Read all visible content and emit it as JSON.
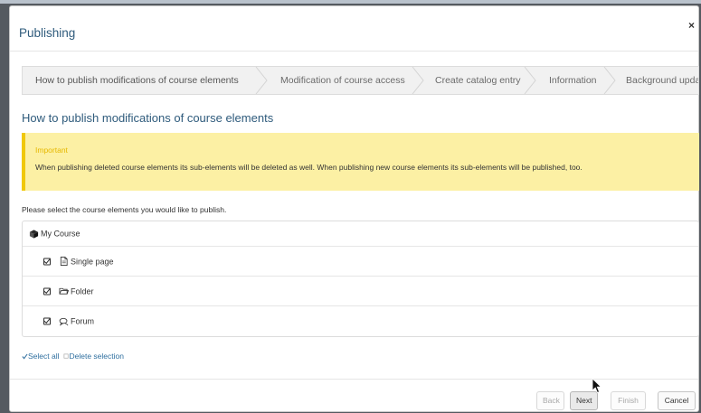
{
  "modal": {
    "title": "Publishing",
    "close_symbol": "×"
  },
  "steps": [
    {
      "label": "How to publish modifications of course elements",
      "active": true
    },
    {
      "label": "Modification of course access",
      "active": false
    },
    {
      "label": "Create catalog entry",
      "active": false
    },
    {
      "label": "Information",
      "active": false
    },
    {
      "label": "Background update",
      "active": false
    }
  ],
  "section_title": "How to publish modifications of course elements",
  "alert": {
    "title": "Important",
    "text": "When publishing deleted course elements its sub-elements will be deleted as well. When publishing new course elements its sub-elements will be published, too.",
    "accent": "#f0c80a"
  },
  "instruction": "Please select the course elements you would like to publish.",
  "tree": {
    "root": {
      "label": "My Course",
      "icon": "course-icon"
    },
    "items": [
      {
        "label": "Single page",
        "icon": "page-icon",
        "checked": true
      },
      {
        "label": "Folder",
        "icon": "folder-icon",
        "checked": true
      },
      {
        "label": "Forum",
        "icon": "forum-icon",
        "checked": true
      }
    ]
  },
  "links": {
    "select_all": "Select all",
    "delete_selection": "Delete selection"
  },
  "buttons": {
    "back": "Back",
    "next": "Next",
    "finish": "Finish",
    "cancel": "Cancel"
  },
  "colors": {
    "title_blue": "#2f5b7c",
    "link_blue": "#2f6f9f",
    "alert_bg": "#fcf0a4"
  }
}
